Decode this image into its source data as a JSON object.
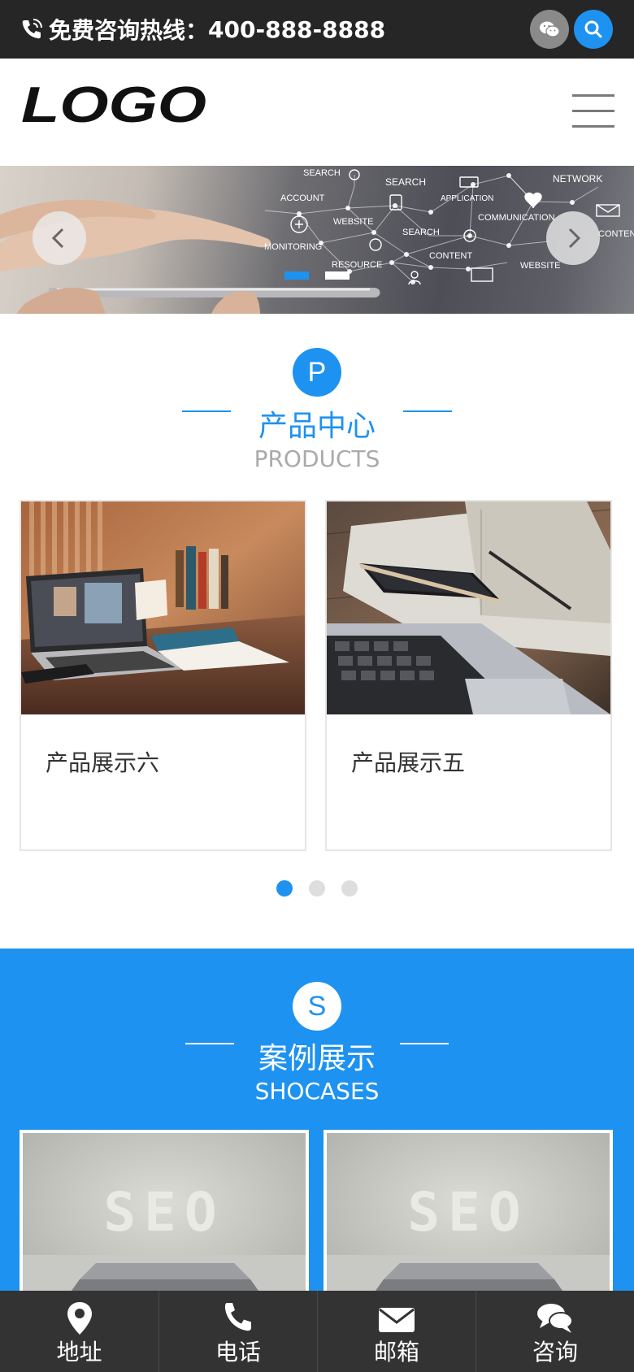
{
  "topbar": {
    "hotline_label": "免费咨询热线：",
    "hotline_number": "400-888-8888",
    "icons": [
      "phone-icon",
      "wechat-icon",
      "search-icon"
    ]
  },
  "header": {
    "logo_text": "LOGO",
    "menu_icon": "menu-icon"
  },
  "banner": {
    "network_words": [
      "SEARCH",
      "SEARCH",
      "NETWORK",
      "ACCOUNT",
      "APPLICATION",
      "WEBSITE",
      "COMMUNICATION",
      "CONTENT",
      "SEARCH",
      "MONITORING",
      "CONTENT",
      "RESOURCE",
      "WEBSITE"
    ],
    "active_slide": 1,
    "slide_count": 2
  },
  "products": {
    "badge": "P",
    "title": "产品中心",
    "subtitle": "PRODUCTS",
    "items": [
      {
        "name": "产品展示六"
      },
      {
        "name": "产品展示五"
      }
    ],
    "pagination": {
      "active": 1,
      "count": 3
    }
  },
  "cases": {
    "badge": "S",
    "title": "案例展示",
    "subtitle": "SHOCASES",
    "items": [
      {
        "image_text": "SEO"
      },
      {
        "image_text": "SEO"
      }
    ]
  },
  "bottom_nav": [
    {
      "label": "地址",
      "icon": "location-icon"
    },
    {
      "label": "电话",
      "icon": "phone-icon"
    },
    {
      "label": "邮箱",
      "icon": "mail-icon"
    },
    {
      "label": "咨询",
      "icon": "chat-icon"
    }
  ],
  "colors": {
    "accent": "#1e92f0",
    "topbar": "#262626",
    "bottom_nav": "#333333"
  }
}
